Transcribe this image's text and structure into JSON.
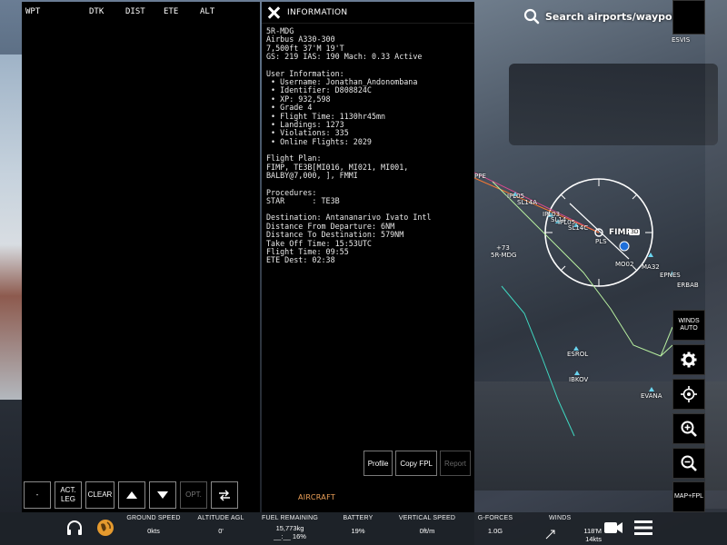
{
  "fpl": {
    "columns": [
      "WPT",
      "DTK",
      "DIST",
      "ETE",
      "ALT"
    ],
    "toolbar": {
      "minus": "-",
      "act_leg": "ACT.\nLEG",
      "clear": "CLEAR",
      "opt": "OPT."
    }
  },
  "info": {
    "title": "INFORMATION",
    "lines": [
      "5R-MDG",
      "Airbus A330-300",
      "7,500ft 37'M 19'T",
      "GS: 219 IAS: 190 Mach: 0.33 Active",
      "",
      "User Information:",
      " • Username: Jonathan_Andonombana",
      " • Identifier: D808824C",
      " • XP: 932,598",
      " • Grade 4",
      " • Flight Time: 1130hr45mn",
      " • Landings: 1273",
      " • Violations: 335",
      " • Online Flights: 2029",
      "",
      "Flight Plan:",
      "FIMP, TE3B[MI016, MI021, MI001,",
      "BALBY@7,000, ], FMMI",
      "",
      "Procedures:",
      "STAR      : TE3B",
      "",
      "Destination: Antananarivo Ivato Intl",
      "Distance From Departure: 6NM",
      "Distance To Destination: 579NM",
      "Take Off Time: 15:53UTC",
      "Flight Time: 09:55",
      "ETE Dest: 02:38"
    ],
    "buttons": {
      "profile": "Profile",
      "copy_fpl": "Copy FPL",
      "report": "Report"
    },
    "tab": "AIRCRAFT"
  },
  "search": {
    "placeholder": "Search airports/waypoints"
  },
  "map": {
    "airport": "FIMP",
    "airport_badge": "3D",
    "waypoints": [
      {
        "id": "ESVIS"
      },
      {
        "id": "IPL05"
      },
      {
        "id": "SL14A"
      },
      {
        "id": "IPL03"
      },
      {
        "id": "SL14"
      },
      {
        "id": "IPL05"
      },
      {
        "id": "SL14C"
      },
      {
        "id": "PLS"
      },
      {
        "id": "MO02"
      },
      {
        "id": "MA32"
      },
      {
        "id": "EPNES"
      },
      {
        "id": "ERBAB"
      },
      {
        "id": "ESROL"
      },
      {
        "id": "IBKOV"
      },
      {
        "id": "EVANA"
      },
      {
        "id": "PPE"
      }
    ],
    "traffic": {
      "callsign": "5R-MDG",
      "alt_delta": "+73"
    }
  },
  "controls": {
    "winds": "WINDS\nAUTO",
    "map_fpl": "MAP+FPL"
  },
  "status": {
    "ground_speed": {
      "label": "GROUND SPEED",
      "value": "0kts"
    },
    "altitude_agl": {
      "label": "ALTITUDE AGL",
      "value": "0'"
    },
    "fuel": {
      "label": "FUEL REMAINING",
      "value": "15,773kg",
      "sub": "__:__ 16%"
    },
    "battery": {
      "label": "BATTERY",
      "value": "19%"
    },
    "vertical_speed": {
      "label": "VERTICAL SPEED",
      "value": "0ft/m"
    },
    "g_forces": {
      "label": "G-FORCES",
      "value": "1.0G"
    },
    "winds": {
      "label": "WINDS",
      "value": "118'M",
      "sub": "14kts"
    }
  },
  "colors": {
    "accent": "#f0a35a",
    "route": "#b8f0a0",
    "track": "#3fd6c0"
  }
}
